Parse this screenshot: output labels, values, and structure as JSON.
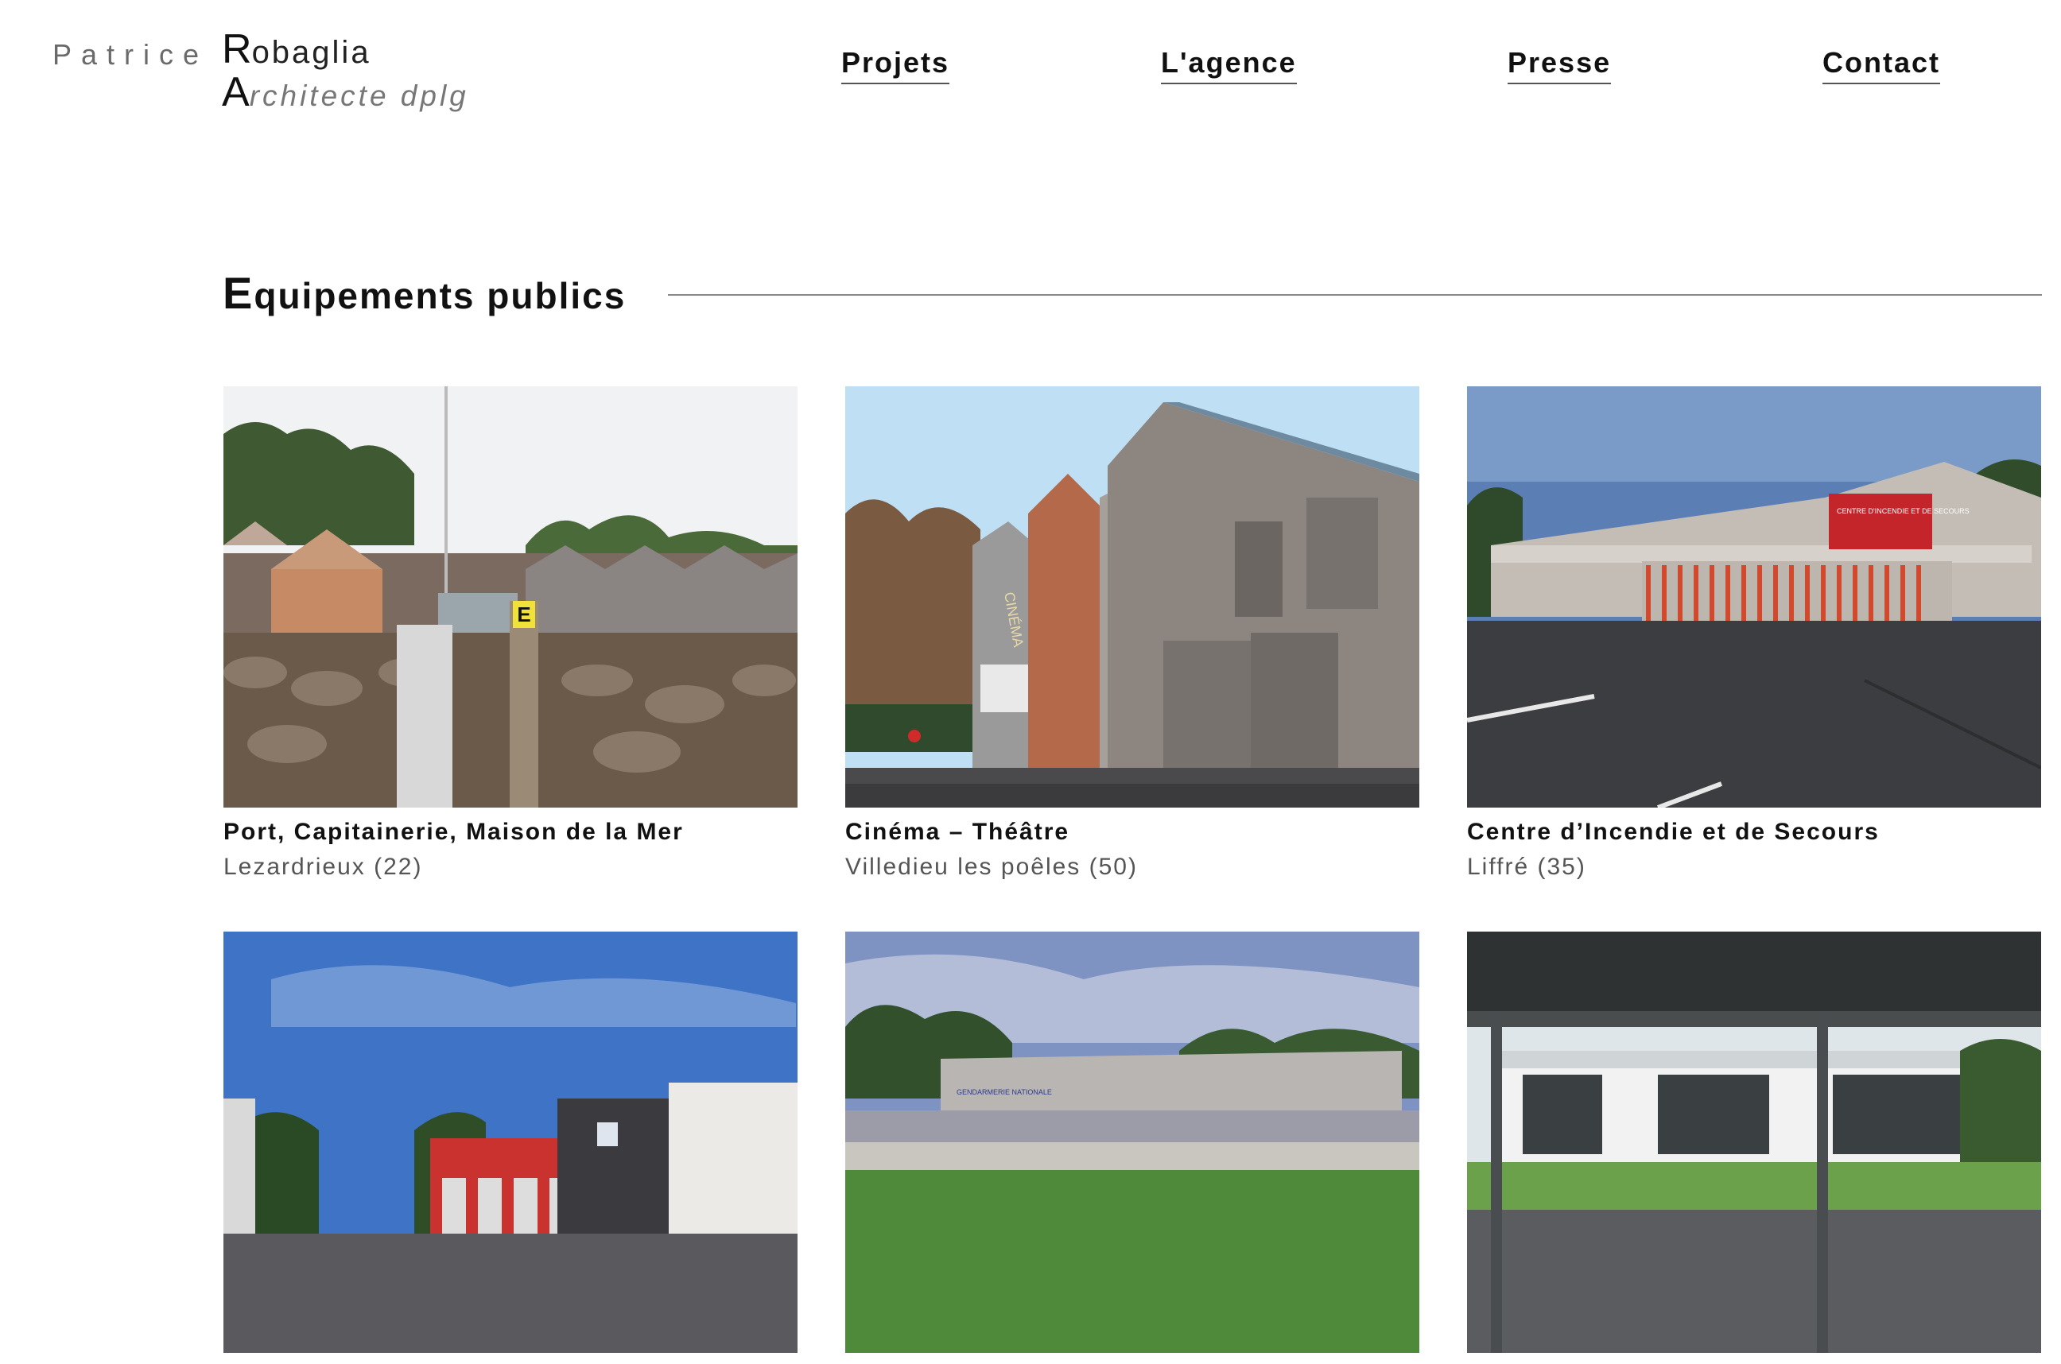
{
  "logo": {
    "first_name": "Patrice",
    "line1_initial": "R",
    "line1_rest": "obaglia",
    "line2_initial": "A",
    "line2_rest": "rchitecte dplg"
  },
  "nav": [
    {
      "label": "Projets"
    },
    {
      "label": "L'agence"
    },
    {
      "label": "Presse"
    },
    {
      "label": "Contact"
    }
  ],
  "section": {
    "title_initial": "E",
    "title_rest": "quipements publics"
  },
  "projects": [
    {
      "title": "Port, Capitainerie, Maison de la Mer",
      "location": "Lezardrieux (22)",
      "sign_text": "E"
    },
    {
      "title": "Cinéma – Théâtre",
      "location": "Villedieu les poêles (50)",
      "sign_text": "CINÉMA"
    },
    {
      "title": "Centre d’Incendie et de Secours",
      "location": "Liffré (35)",
      "sign_text": "CENTRE D'INCENDIE ET DE SECOURS"
    },
    {
      "title": "",
      "location": ""
    },
    {
      "title": "",
      "location": "",
      "sign_text": "GENDARMERIE NATIONALE"
    },
    {
      "title": "",
      "location": ""
    }
  ],
  "colors": {
    "nav_underline": "#555555",
    "logo_grey": "#6a6a6a",
    "secondary_text": "#555555"
  }
}
